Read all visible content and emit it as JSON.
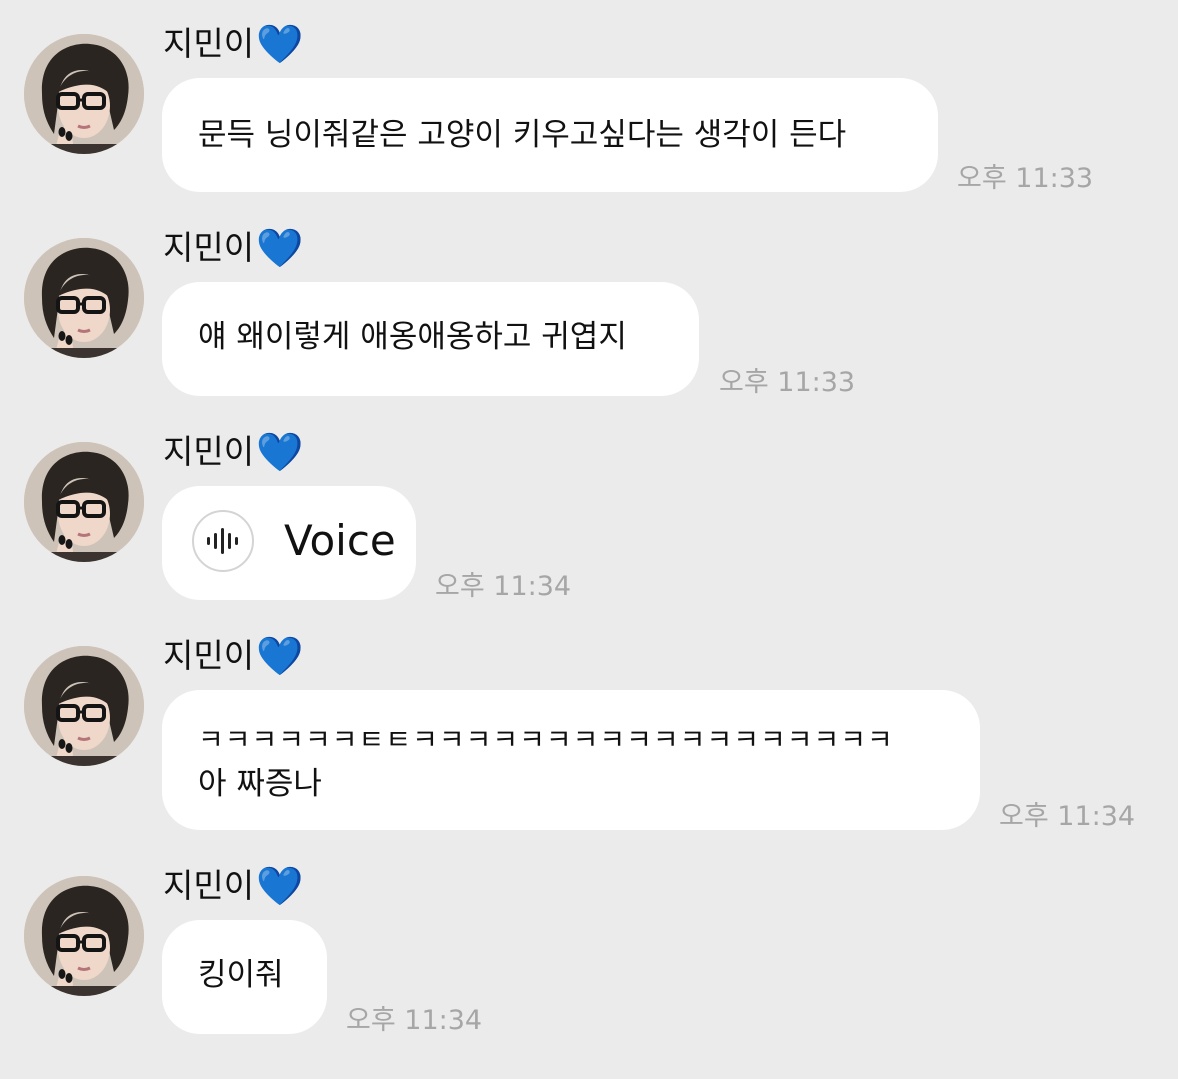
{
  "chat": {
    "messages": [
      {
        "sender": "지민이",
        "heart": "💙",
        "type": "text",
        "text": "문득 닝이줘같은 고양이 키우고싶다는 생각이 든다",
        "time": "오후 11:33"
      },
      {
        "sender": "지민이",
        "heart": "💙",
        "type": "text",
        "text": "얘 왜이렇게 애옹애옹하고 귀엽지",
        "time": "오후 11:33"
      },
      {
        "sender": "지민이",
        "heart": "💙",
        "type": "voice",
        "text": "Voice",
        "icon": "audio-waveform-icon",
        "time": "오후 11:34"
      },
      {
        "sender": "지민이",
        "heart": "💙",
        "type": "text",
        "line1": "ㅋㅋㅋㅋㅋㅋㅌㅌㅋㅋㅋㅋㅋㅋㅋㅋㅋㅋㅋㅋㅋㅋㅋㅋㅋㅋ",
        "line2": "아 짜증나",
        "time": "오후 11:34"
      },
      {
        "sender": "지민이",
        "heart": "💙",
        "type": "text",
        "text": "킹이줘",
        "time": "오후 11:34"
      }
    ]
  },
  "colors": {
    "background": "#ebebeb",
    "bubble": "#ffffff",
    "timestamp": "#a6a6a6",
    "heart": "#2f7ef5"
  }
}
